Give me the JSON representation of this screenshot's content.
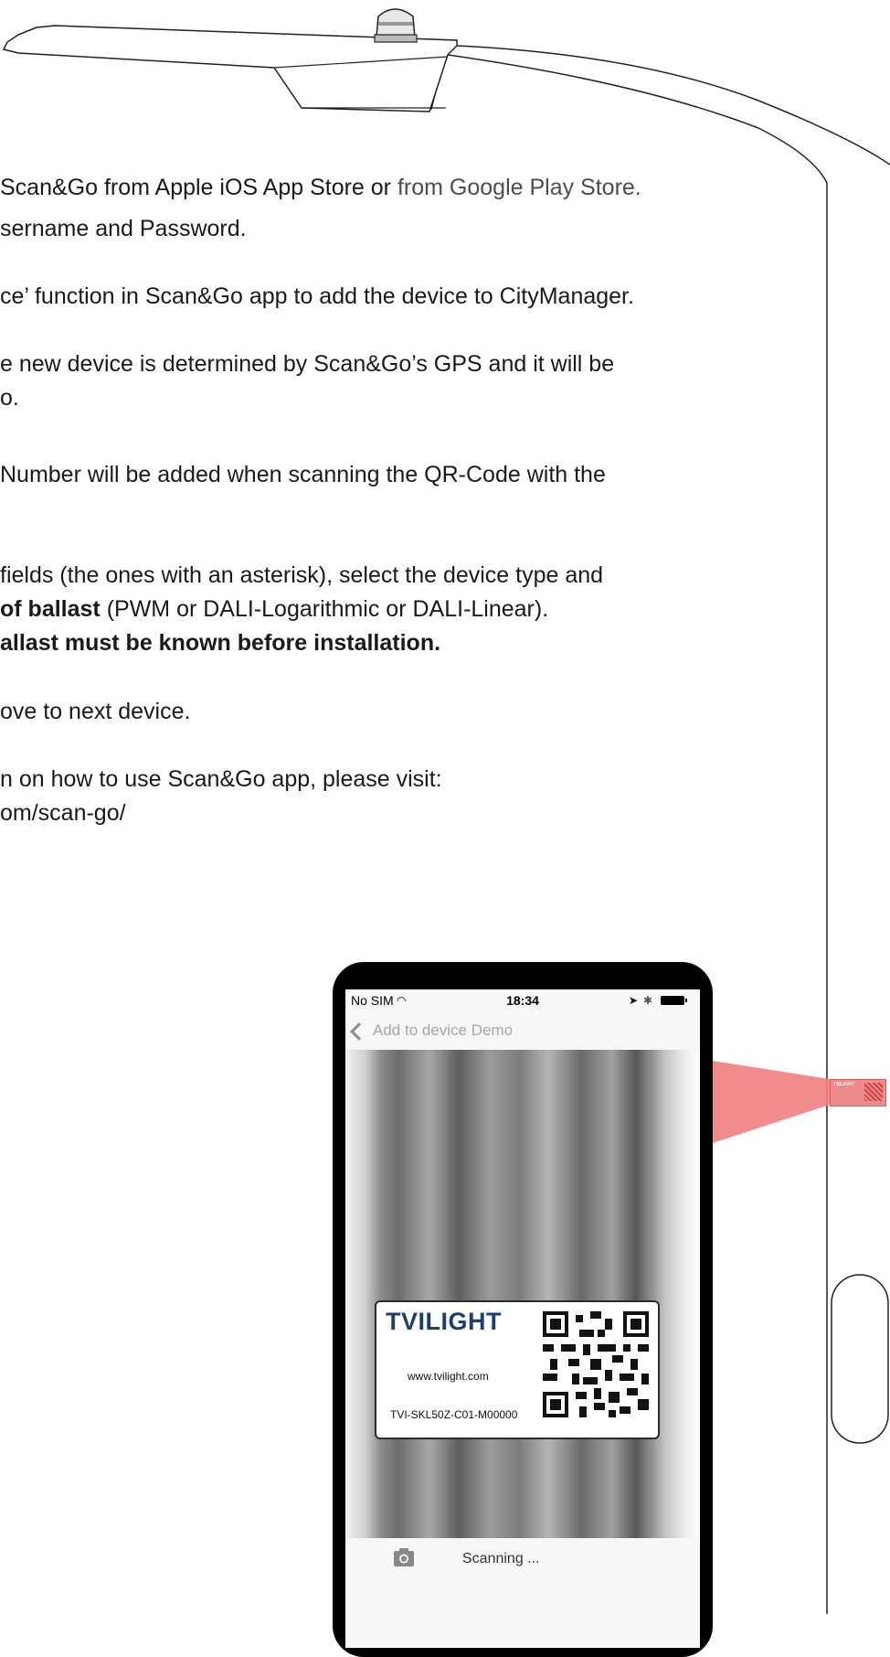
{
  "steps": {
    "download": {
      "text": "Scan&Go from Apple iOS App Store or",
      "link": "from Google Play Store."
    },
    "login": "sername and Password.",
    "add_device": "ce’ function in Scan&Go app to add the device to CityManager.",
    "gps_line1": "e new device is determined by Scan&Go’s GPS and it will be",
    "gps_line2": "o.",
    "serial": " Number will be added when scanning the QR-Code with the",
    "fields_line1": " fields (the ones with an asterisk), select the device type and",
    "fields_line2_bold": "of ballast",
    "fields_line2_rest": " (PWM or DALI-Logarithmic or DALI-Linear).",
    "fields_line3_bold": "allast must be known before installation.",
    "next": "ove to next device.",
    "more_info_line1": "n on how to use Scan&Go app, please visit:",
    "more_info_line2": "om/scan-go/"
  },
  "phone": {
    "status_bar": {
      "carrier": "No SIM",
      "time": "18:34"
    },
    "nav": {
      "title": "Add to device Demo"
    },
    "tag": {
      "brand": "TVILIGHT",
      "url": "www.tvilight.com",
      "serial": "TVI-SKL50Z-C01-M00000"
    },
    "status_text": "Scanning ..."
  },
  "device_sticker": {
    "brand": "TVILIGHT"
  },
  "colors": {
    "text": "#1a1a1a",
    "link": "#4d4d4d",
    "brand": "#1c3f73",
    "scan_beam": "#f07f7f",
    "outline": "#222222"
  },
  "icons": [
    "wifi-icon",
    "location-arrow-icon",
    "bluetooth-icon",
    "battery-icon",
    "back-chevron-icon",
    "camera-icon",
    "qr-code-icon"
  ]
}
